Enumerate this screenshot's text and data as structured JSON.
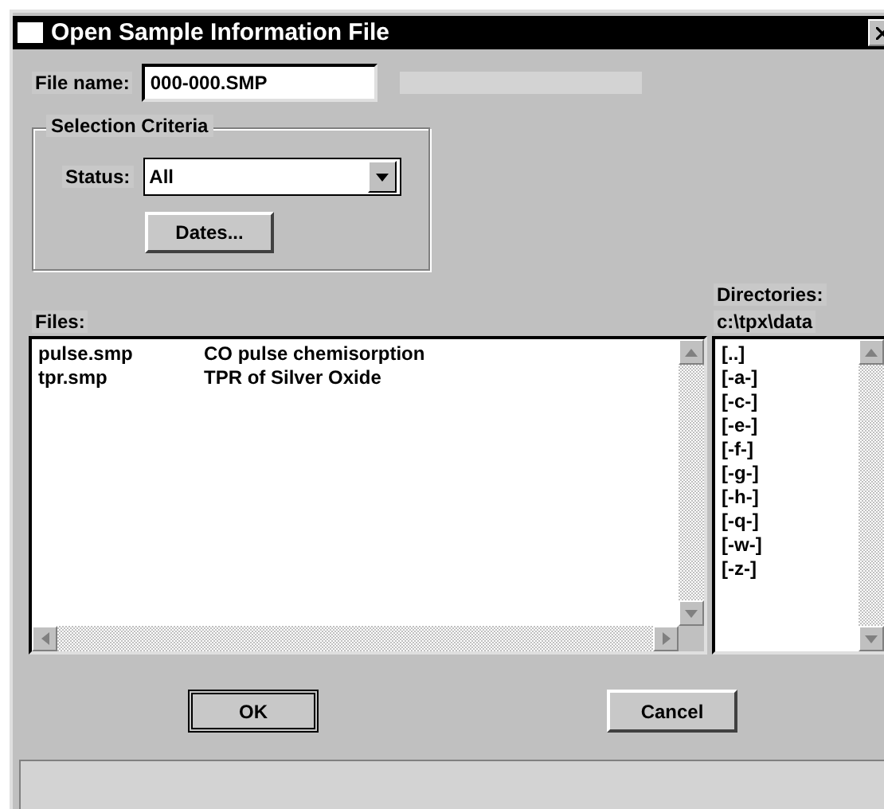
{
  "window": {
    "title": "Open Sample Information File"
  },
  "file_name": {
    "label": "File name:",
    "value": "000-000.SMP"
  },
  "selection_criteria": {
    "title": "Selection Criteria",
    "status_label": "Status:",
    "status_value": "All",
    "dates_button": "Dates..."
  },
  "files": {
    "label": "Files:",
    "rows": [
      {
        "name": "pulse.smp",
        "description": "CO pulse chemisorption"
      },
      {
        "name": "tpr.smp",
        "description": "TPR of Silver Oxide"
      }
    ]
  },
  "directories": {
    "label": "Directories:",
    "path": "c:\\tpx\\data",
    "items": [
      "[..]",
      "[-a-]",
      "[-c-]",
      "[-e-]",
      "[-f-]",
      "[-g-]",
      "[-h-]",
      "[-q-]",
      "[-w-]",
      "[-z-]"
    ]
  },
  "buttons": [
    {
      "label": "OK",
      "default": true
    },
    {
      "label": "Cancel",
      "default": false
    }
  ]
}
